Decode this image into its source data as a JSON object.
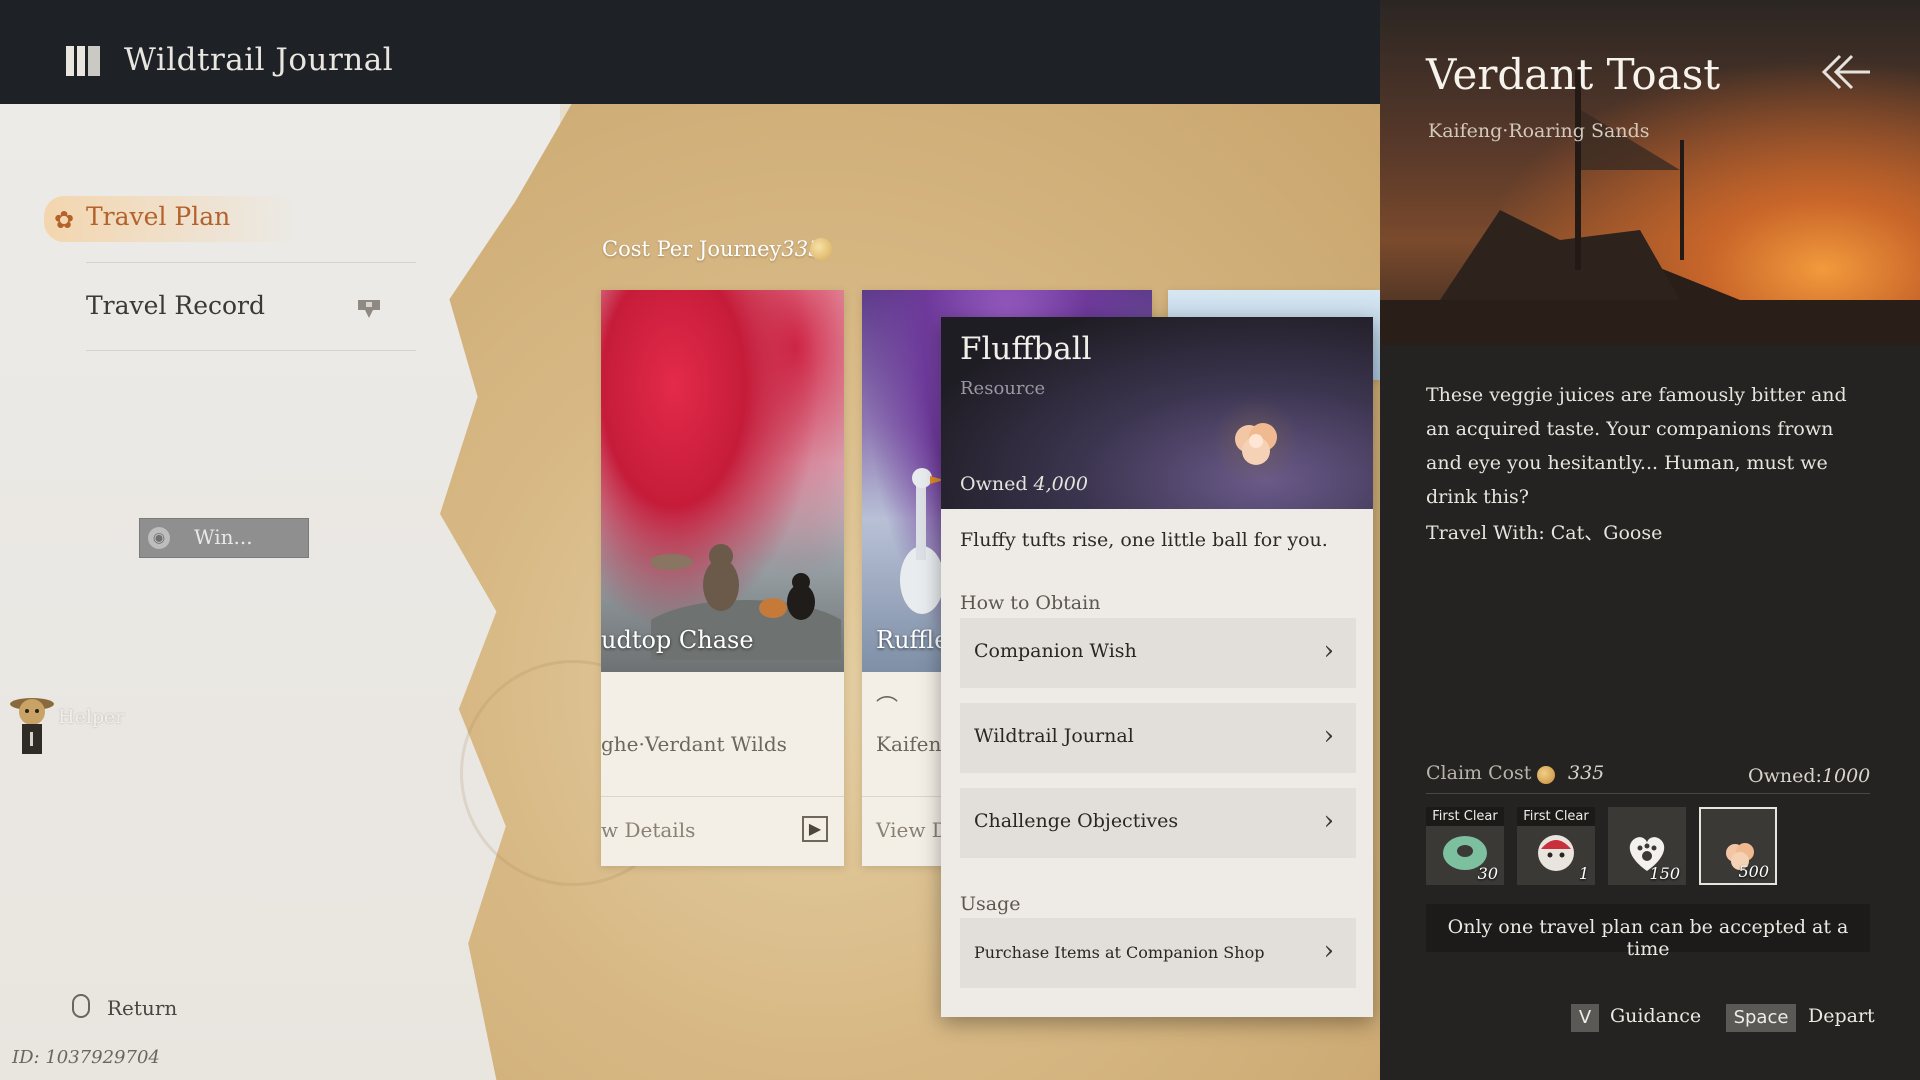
{
  "app": {
    "title": "Wildtrail Journal",
    "icon": "journal-book-icon"
  },
  "sidebar": {
    "items": [
      {
        "label": "Travel Plan",
        "active": true,
        "icon": "paw-icon"
      },
      {
        "label": "Travel Record",
        "active": false,
        "icon": "record-badge-icon"
      }
    ],
    "voice_chip": "Win...",
    "helper_label": "Helper",
    "return_label": "Return",
    "player_id": "ID: 1037929704"
  },
  "journey": {
    "cost_label": "Cost Per Journey",
    "cost_value": "335",
    "cards": [
      {
        "title": "udtop Chase",
        "region": "ghe·Verdant Wilds",
        "details": "w Details"
      },
      {
        "title": "Ruffle",
        "region": "Kaifeng",
        "details": "View De"
      }
    ]
  },
  "tooltip": {
    "name": "Fluffball",
    "type": "Resource",
    "owned_label": "Owned",
    "owned_value": "4,000",
    "description": "Fluffy tufts rise, one little ball for you.",
    "how_to_obtain": "How to Obtain",
    "obtain_items": [
      "Companion Wish",
      "Wildtrail Journal",
      "Challenge Objectives"
    ],
    "usage_heading": "Usage",
    "usage_items": [
      "Purchase Items at Companion Shop"
    ]
  },
  "detail": {
    "title": "Verdant Toast",
    "subtitle": "Kaifeng·Roaring Sands",
    "description": "These veggie juices are famously bitter and an acquired taste. Your companions frown and eye you hesitantly... Human, must we drink this?",
    "travel_with": "Travel With: Cat、Goose",
    "claim_cost_label": "Claim Cost",
    "claim_cost_value": "335",
    "owned_label": "Owned:",
    "owned_value": "1000",
    "rewards": [
      {
        "badge": "First Clear",
        "qty": "30",
        "icon": "jade-ring-icon"
      },
      {
        "badge": "First Clear",
        "qty": "1",
        "icon": "companion-portrait-icon"
      },
      {
        "badge": "",
        "qty": "150",
        "icon": "paw-heart-icon"
      },
      {
        "badge": "",
        "qty": "500",
        "icon": "fluffball-icon",
        "selected": true
      }
    ],
    "notice": "Only one travel plan can be accepted at a time",
    "controls": [
      {
        "key": "V",
        "label": "Guidance"
      },
      {
        "key": "Space",
        "label": "Depart"
      }
    ]
  }
}
